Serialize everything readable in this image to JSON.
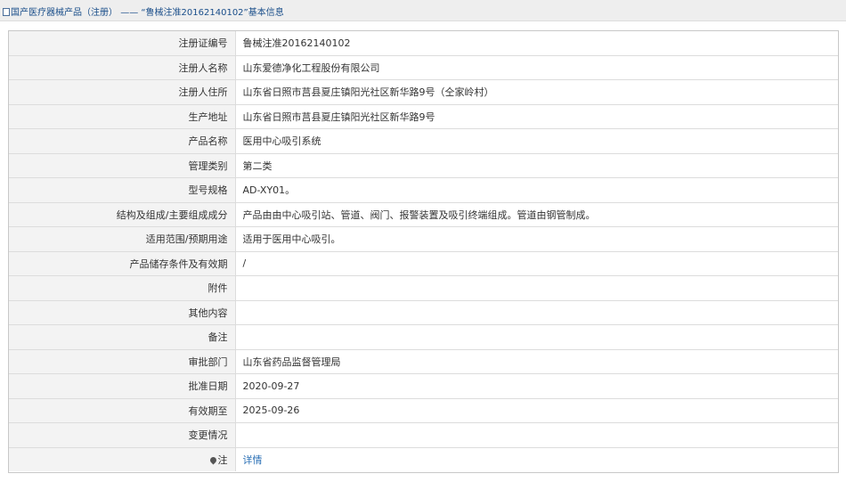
{
  "breadcrumb": {
    "root": "国产医疗器械产品（注册）",
    "sep": "——",
    "current": "“鲁械注准20162140102”基本信息"
  },
  "rows": [
    {
      "label": "注册证编号",
      "value": "鲁械注准20162140102"
    },
    {
      "label": "注册人名称",
      "value": "山东爱德净化工程股份有限公司"
    },
    {
      "label": "注册人住所",
      "value": "山东省日照市莒县夏庄镇阳光社区新华路9号（仝家岭村）"
    },
    {
      "label": "生产地址",
      "value": "山东省日照市莒县夏庄镇阳光社区新华路9号"
    },
    {
      "label": "产品名称",
      "value": "医用中心吸引系统"
    },
    {
      "label": "管理类别",
      "value": "第二类"
    },
    {
      "label": "型号规格",
      "value": "AD-XY01。"
    },
    {
      "label": "结构及组成/主要组成成分",
      "value": "产品由由中心吸引站、管道、阀门、报警装置及吸引终端组成。管道由钢管制成。"
    },
    {
      "label": "适用范围/预期用途",
      "value": "适用于医用中心吸引。"
    },
    {
      "label": "产品储存条件及有效期",
      "value": "/"
    },
    {
      "label": "附件",
      "value": ""
    },
    {
      "label": "其他内容",
      "value": ""
    },
    {
      "label": "备注",
      "value": ""
    },
    {
      "label": "审批部门",
      "value": "山东省药品监督管理局"
    },
    {
      "label": "批准日期",
      "value": "2020-09-27"
    },
    {
      "label": "有效期至",
      "value": "2025-09-26"
    },
    {
      "label": "变更情况",
      "value": ""
    }
  ],
  "note": {
    "label": "注",
    "link": "详情"
  }
}
